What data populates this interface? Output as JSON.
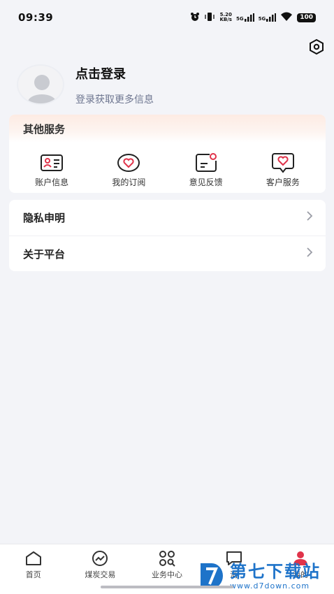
{
  "status_bar": {
    "time": "09:39",
    "speed": "5.20",
    "speed_unit": "KB/s",
    "net1": "5G",
    "net2": "5G",
    "battery": "100",
    "icons": [
      "alarm-icon",
      "vibrate-icon",
      "signal-icon",
      "signal-icon",
      "wifi-icon",
      "battery-icon"
    ]
  },
  "header": {
    "settings_icon": "hexagon-settings-icon"
  },
  "profile": {
    "title": "点击登录",
    "subtitle": "登录获取更多信息"
  },
  "services": {
    "title": "其他服务",
    "accent": "#e0334a",
    "items": [
      {
        "label": "账户信息",
        "icon": "id-card-icon"
      },
      {
        "label": "我的订阅",
        "icon": "heart-circle-icon"
      },
      {
        "label": "意见反馈",
        "icon": "feedback-icon"
      },
      {
        "label": "客户服务",
        "icon": "heart-chat-icon"
      }
    ]
  },
  "menu": {
    "items": [
      {
        "label": "隐私申明"
      },
      {
        "label": "关于平台"
      }
    ]
  },
  "tabbar": {
    "active_color": "#e0334a",
    "tabs": [
      {
        "label": "首页",
        "icon": "home-icon"
      },
      {
        "label": "煤炭交易",
        "icon": "trend-icon"
      },
      {
        "label": "业务中心",
        "icon": "grid-icon"
      },
      {
        "label": "消",
        "icon": "message-icon"
      },
      {
        "label": "我的",
        "icon": "user-icon"
      }
    ]
  },
  "watermark": {
    "title": "第七下载站",
    "url": "www.d7down.com"
  }
}
